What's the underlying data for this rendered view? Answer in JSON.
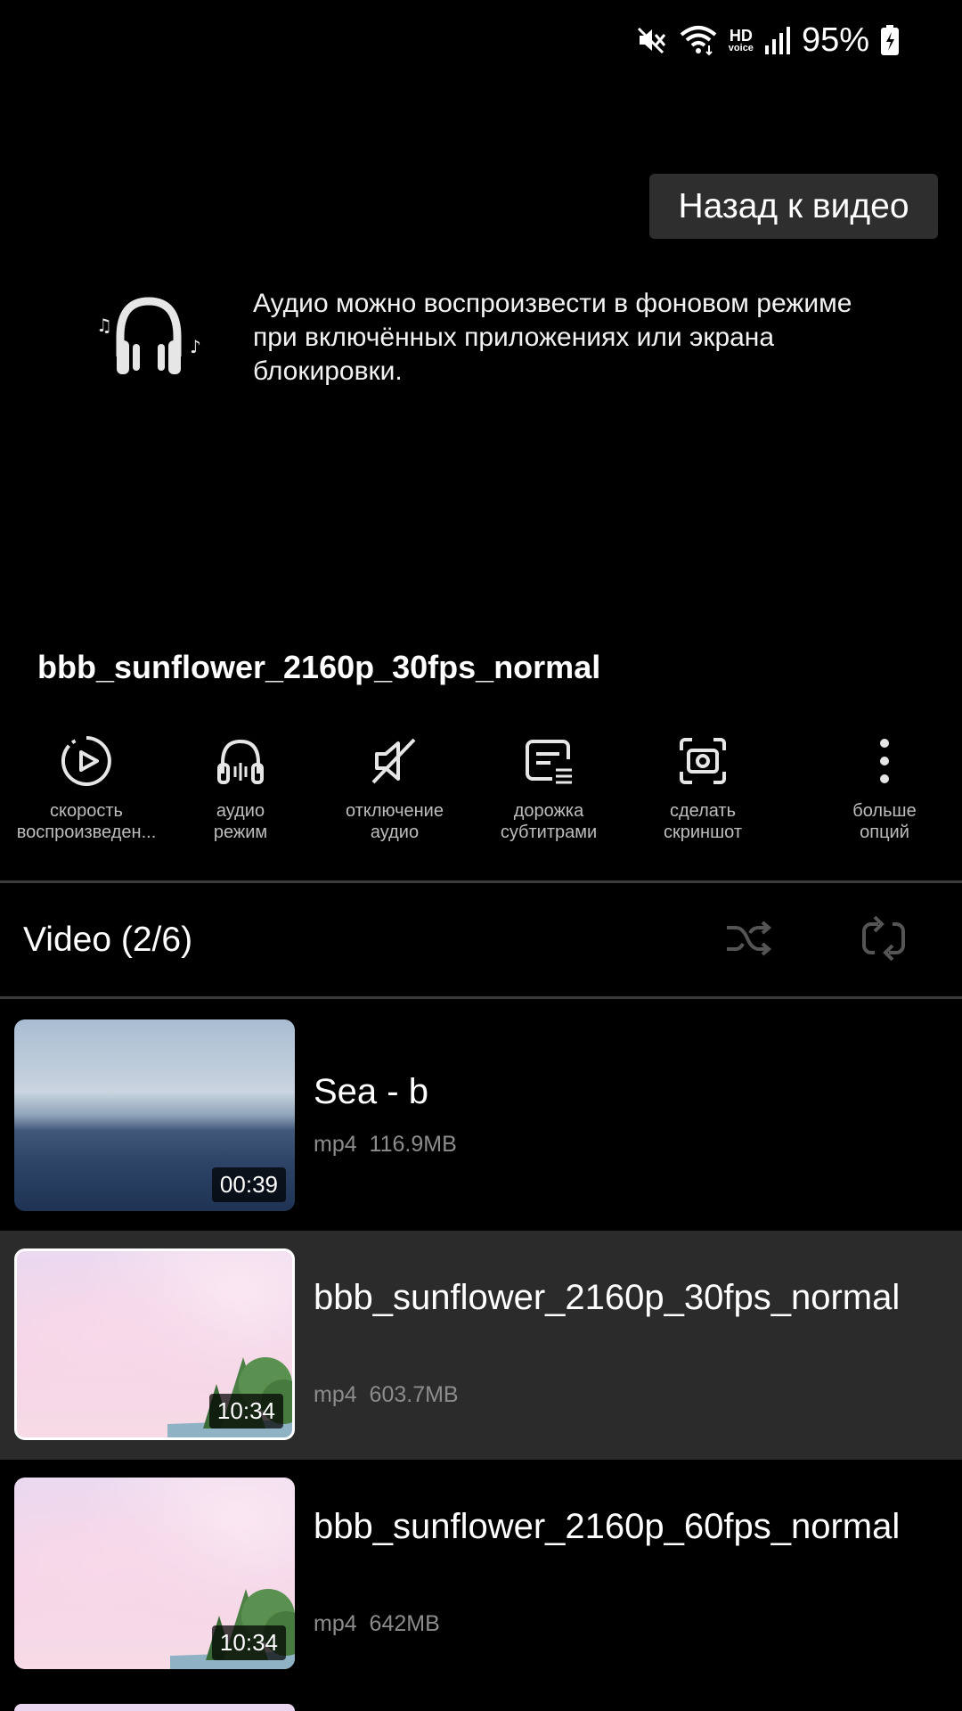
{
  "status_bar": {
    "hd": "HD",
    "voice": "voice",
    "battery": "95%"
  },
  "back_button": "Назад к видео",
  "audio_notice": "Аудио можно воспроизвести в фоновом режиме при включённых приложениях или экрана блокировки.",
  "video_title": "bbb_sunflower_2160p_30fps_normal",
  "toolbar": [
    {
      "label": "скорость\nвоспроизведен...",
      "icon": "playback-speed-icon"
    },
    {
      "label": "аудио\nрежим",
      "icon": "headphones-icon"
    },
    {
      "label": "отключение\nаудио",
      "icon": "mute-icon"
    },
    {
      "label": "дорожка\nсубтитрами",
      "icon": "subtitles-icon"
    },
    {
      "label": "сделать\nскриншот",
      "icon": "screenshot-icon"
    },
    {
      "label": "больше\nопций",
      "icon": "more-options-icon"
    }
  ],
  "playlist": {
    "title": "Video (2/6)",
    "items": [
      {
        "title": "Sea - b",
        "format": "mp4",
        "size": "116.9MB",
        "duration": "00:39",
        "active": false
      },
      {
        "title": "bbb_sunflower_2160p_30fps_normal",
        "format": "mp4",
        "size": "603.7MB",
        "duration": "10:34",
        "active": true
      },
      {
        "title": "bbb_sunflower_2160p_60fps_normal",
        "format": "mp4",
        "size": "642MB",
        "duration": "10:34",
        "active": false
      }
    ]
  }
}
